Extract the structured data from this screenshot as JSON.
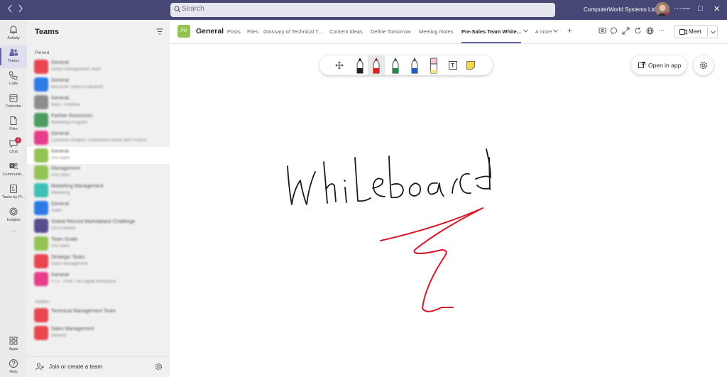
{
  "titlebar": {
    "search_placeholder": "Search",
    "org_name": "ComputerWorld Systems Ltd ⌄",
    "back_icon": "chevron-left-icon",
    "forward_icon": "chevron-right-icon",
    "minimize": "—",
    "maximize": "□",
    "close": "✕",
    "more": "···"
  },
  "rail": {
    "items": [
      {
        "label": "Activity",
        "icon": "bell-icon"
      },
      {
        "label": "Teams",
        "icon": "teams-icon"
      },
      {
        "label": "Calls",
        "icon": "phone-icon"
      },
      {
        "label": "Calendar",
        "icon": "calendar-icon"
      },
      {
        "label": "Files",
        "icon": "file-icon"
      },
      {
        "label": "Chat",
        "icon": "chat-icon",
        "badge": "1"
      },
      {
        "label": "Communiti...",
        "icon": "communities-icon"
      },
      {
        "label": "Tasks by Pl...",
        "icon": "tasks-icon"
      },
      {
        "label": "Insights",
        "icon": "insights-icon"
      },
      {
        "label": "···",
        "icon": "more-icon"
      },
      {
        "label": "Apps",
        "icon": "apps-icon"
      },
      {
        "label": "Help",
        "icon": "help-icon"
      }
    ]
  },
  "teams_panel": {
    "title": "Teams",
    "pinned_label": "Pinned",
    "hidden_label": "Hidden",
    "join_label": "Join or create a team",
    "teams": [
      {
        "name": "General",
        "sub": "Senior Management Team",
        "color": "#e8474f"
      },
      {
        "name": "General",
        "sub": "Microsoft Teams Evaluation",
        "color": "#2f7be6"
      },
      {
        "name": "General",
        "sub": "Mary - Portfolio",
        "color": "#8c8c8c"
      },
      {
        "name": "Partner Resources",
        "sub": "Marketing Program",
        "color": "#4a9b5e"
      },
      {
        "name": "General",
        "sub": "Customer Insights, Connected Clients and Product",
        "color": "#e83d8a"
      },
      {
        "name": "General",
        "sub": "Pre-Sales",
        "color": "#92c353"
      },
      {
        "name": "Management",
        "sub": "Pre-Sales",
        "color": "#92c353"
      },
      {
        "name": "Marketing Management",
        "sub": "Marketing",
        "color": "#3ec0b4"
      },
      {
        "name": "General",
        "sub": "Sales",
        "color": "#2f7be6"
      },
      {
        "name": "Global Record Marketplace Challenge",
        "sub": "2023 Awards",
        "color": "#5a4d8c"
      },
      {
        "name": "Team Goals",
        "sub": "Pre-Sales",
        "color": "#92c353"
      },
      {
        "name": "Strategic Tasks",
        "sub": "Sales Management",
        "color": "#e8474f"
      },
      {
        "name": "General",
        "sub": "FY3 - Think The Digital Workplace",
        "color": "#e83d8a"
      }
    ],
    "hidden_teams": [
      {
        "name": "Technical Management Team",
        "sub": "",
        "color": "#e8474f"
      },
      {
        "name": "Sales Management",
        "sub": "General",
        "color": "#e8474f"
      }
    ]
  },
  "header": {
    "team_initials": "PR",
    "channel": "General",
    "tabs": [
      "Posts",
      "Files",
      "Glossary of Technical T...",
      "Content Ideas",
      "Define Tomorrow",
      "Meeting Notes",
      "Pre-Sales Team White...",
      "4 more"
    ],
    "active_tab": "Pre-Sales Team White...",
    "add_tab": "+",
    "meet_label": "Meet"
  },
  "canvas": {
    "open_in_app": "Open in app",
    "tools": [
      {
        "name": "lasso-tool",
        "color": "#444444"
      },
      {
        "name": "black-pen",
        "color": "#222222"
      },
      {
        "name": "red-pen",
        "color": "#e02020"
      },
      {
        "name": "green-pen",
        "color": "#1f8a4c"
      },
      {
        "name": "blue-pen",
        "color": "#1e5fbf"
      },
      {
        "name": "highlighter",
        "color": "#f0c8d8"
      },
      {
        "name": "text-tool",
        "color": "#444444"
      },
      {
        "name": "sticky-note",
        "color": "#f5d54a"
      }
    ],
    "ink_colors": {
      "text": "#1a1a1a",
      "bolt": "#d8182a"
    }
  },
  "colors": {
    "accent": "#6264a7",
    "titlebar": "#464775"
  }
}
